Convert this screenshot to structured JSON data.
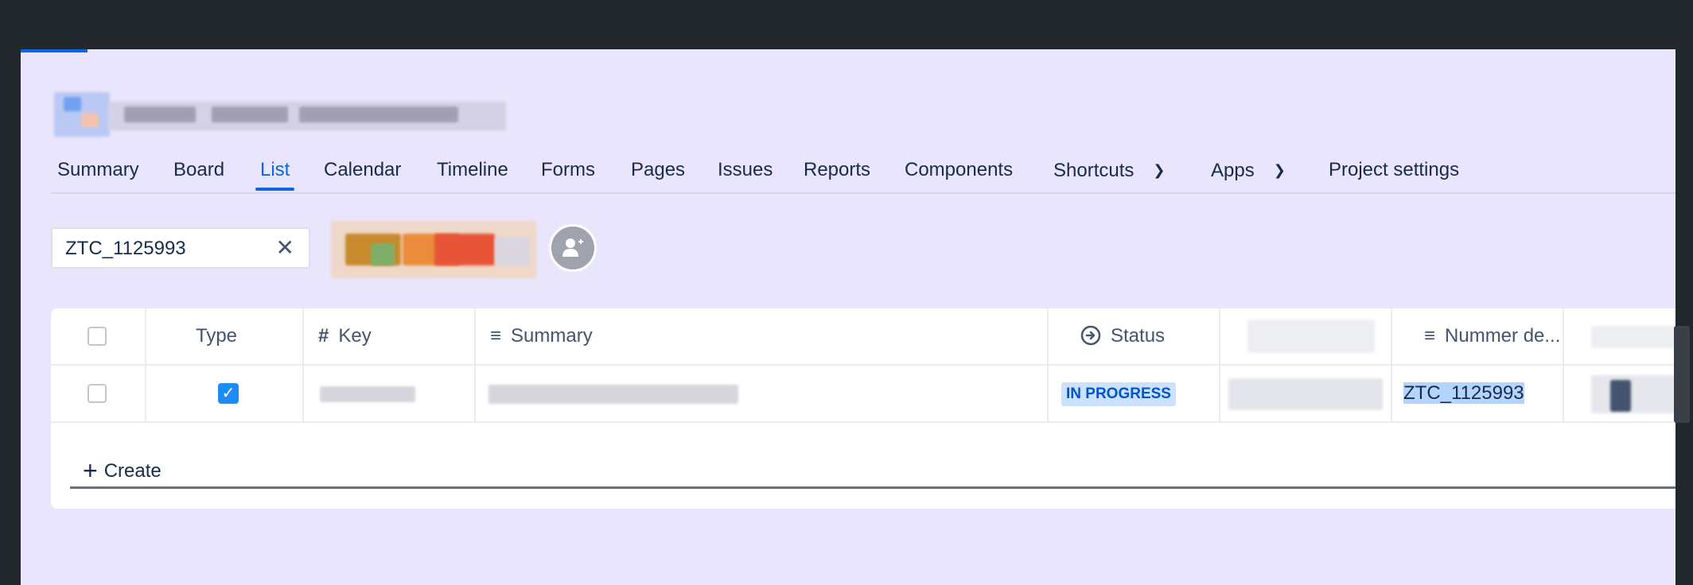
{
  "tabs": [
    {
      "label": "Summary"
    },
    {
      "label": "Board"
    },
    {
      "label": "List"
    },
    {
      "label": "Calendar"
    },
    {
      "label": "Timeline"
    },
    {
      "label": "Forms"
    },
    {
      "label": "Pages"
    },
    {
      "label": "Issues"
    },
    {
      "label": "Reports"
    },
    {
      "label": "Components"
    },
    {
      "label": "Shortcuts"
    },
    {
      "label": "Apps"
    },
    {
      "label": "Project settings"
    }
  ],
  "active_tab": "List",
  "search": {
    "value": "ZTC_1125993"
  },
  "table": {
    "columns": {
      "type": "Type",
      "key": "Key",
      "summary": "Summary",
      "status": "Status",
      "nummer": "Nummer de..."
    },
    "rows": [
      {
        "status": "IN PROGRESS",
        "nummer": "ZTC_1125993",
        "type_checked": true
      }
    ]
  },
  "create_label": "Create",
  "icons": {
    "clear": "close-icon",
    "add_people": "add-people-icon",
    "key_col": "hash-icon",
    "summary_col": "text-lines-icon",
    "status_col": "status-arrow-icon",
    "chevron": "chevron-down-icon"
  },
  "colors": {
    "page_bg": "#e9e5fc",
    "accent": "#0c66e4",
    "status_bg": "#cce0ff",
    "status_fg": "#0055cc"
  }
}
